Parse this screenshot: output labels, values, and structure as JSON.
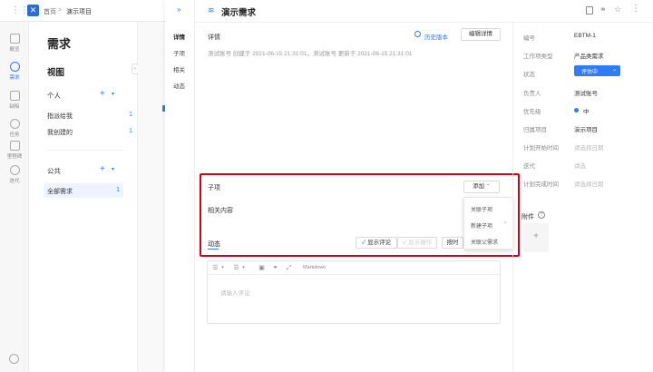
{
  "topbar": {
    "breadcrumb_home": "首页",
    "breadcrumb_sep": ">",
    "breadcrumb_project": "演示项目"
  },
  "rail": {
    "items": [
      {
        "label": "概览"
      },
      {
        "label": "需求"
      },
      {
        "label": "缺陷"
      },
      {
        "label": "任务"
      },
      {
        "label": "里程碑"
      },
      {
        "label": "迭代"
      }
    ]
  },
  "sidebar": {
    "title": "需求",
    "views_title": "视图",
    "personal_title": "个人",
    "personal_items": [
      {
        "label": "指派给我",
        "count": "1"
      },
      {
        "label": "我创建的",
        "count": "1"
      }
    ],
    "public_title": "公共",
    "public_items": [
      {
        "label": "全部需求",
        "count": "1"
      }
    ]
  },
  "nav": {
    "collapse_icon": "»",
    "items": [
      "详情",
      "子项",
      "相关",
      "动态"
    ]
  },
  "detail": {
    "title": "演示需求",
    "details_label": "详情",
    "history_link": "历史版本",
    "edit_button": "编辑详情",
    "meta_text": "测试账号 创建于 2021-06-15 21:31:01，测试账号 更新于 2021-06-15 21:31:01",
    "subitems_label": "子项",
    "add_button": "添加",
    "related_label": "相关内容",
    "activity_tab": "动态",
    "show_comments": "显示评论",
    "show_ops": "显示操作",
    "sort_button": "按时",
    "markdown_label": "Markdown",
    "comment_placeholder": "请输入评论"
  },
  "dropdown": {
    "items": [
      "关联子项",
      "新建子项",
      "关联父需求"
    ]
  },
  "fields": {
    "number_label": "编号",
    "number_value": "EBTM-1",
    "type_label": "工作项类型",
    "type_value": "产品类需求",
    "status_label": "状态",
    "status_value": "评估中",
    "owner_label": "负责人",
    "owner_value": "测试账号",
    "priority_label": "优先级",
    "priority_value": "中",
    "project_label": "归属项目",
    "project_value": "演示项目",
    "start_label": "计划开始时间",
    "start_value": "请选择日期",
    "iteration_label": "迭代",
    "iteration_value": "请选",
    "end_label": "计划完成时间",
    "end_value": "请选择日期",
    "attachments_label": "附件",
    "add_attachment": "+"
  },
  "colors": {
    "accent": "#2f7cf6",
    "highlight": "#d0021b",
    "priority_dot": "#2f7cf6"
  }
}
